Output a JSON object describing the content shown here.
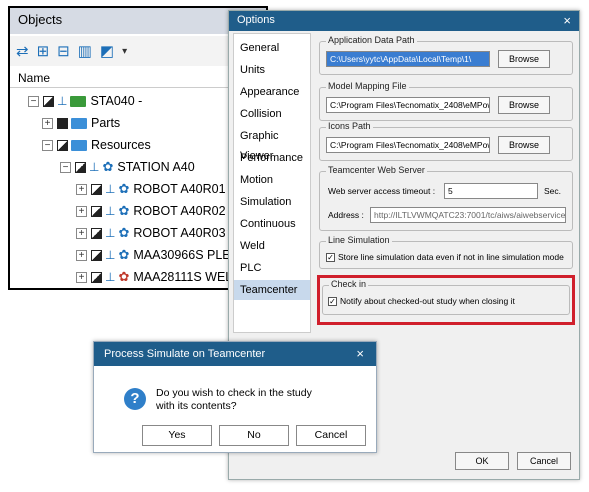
{
  "objects_panel": {
    "title": "Objects",
    "column_header": "Name",
    "tree": [
      {
        "expander": "−",
        "label": "STA040 -"
      },
      {
        "expander": "+",
        "label": "Parts"
      },
      {
        "expander": "−",
        "label": "Resources"
      },
      {
        "expander": "−",
        "label": "STATION A40"
      },
      {
        "expander": "+",
        "label": "ROBOT A40R01 F"
      },
      {
        "expander": "+",
        "label": "ROBOT A40R02 F"
      },
      {
        "expander": "+",
        "label": "ROBOT A40R03 F"
      },
      {
        "expander": "+",
        "label": "MAA30966S PLEN"
      },
      {
        "expander": "+",
        "label": "MAA28111S WEL"
      }
    ]
  },
  "options_dialog": {
    "title": "Options",
    "close": "×",
    "nav_items": [
      "General",
      "Units",
      "Appearance",
      "Collision",
      "Graphic Viewer",
      "Performance",
      "Motion",
      "Simulation",
      "Continuous",
      "Weld",
      "PLC",
      "Teamcenter"
    ],
    "selected_nav": "Teamcenter",
    "app_data_path": {
      "title": "Application Data Path",
      "value": "C:\\Users\\yytc\\AppData\\Local\\Temp\\1\\",
      "browse": "Browse"
    },
    "model_mapping": {
      "title": "Model Mapping File",
      "value": "C:\\Program Files\\Tecnomatix_2408\\eMPower\\Te",
      "browse": "Browse"
    },
    "icons_path": {
      "title": "Icons Path",
      "value": "C:\\Program Files\\Tecnomatix_2408\\eMPower\\Te",
      "browse": "Browse"
    },
    "tc_web_server": {
      "title": "Teamcenter Web Server",
      "timeout_label": "Web server access timeout :",
      "timeout_value": "5",
      "timeout_unit": "Sec.",
      "address_label": "Address :",
      "address_value": "http://ILTLVWMQATC23:7001/tc/aiws/aiwebservice"
    },
    "line_simulation": {
      "title": "Line Simulation",
      "checkbox_label": "Store line simulation data even if not in line simulation mode",
      "checked": true
    },
    "check_in": {
      "title": "Check in",
      "checkbox_label": "Notify about checked-out study when closing it",
      "checked": true
    },
    "ok": "OK",
    "cancel": "Cancel",
    "highlight_color": "#d01f2c"
  },
  "ps_dialog": {
    "title": "Process Simulate on Teamcenter",
    "close": "×",
    "message_line1": "Do you wish to check in the study",
    "message_line2": "with its contents?",
    "yes": "Yes",
    "no": "No",
    "cancel": "Cancel",
    "icon": "question-icon"
  }
}
